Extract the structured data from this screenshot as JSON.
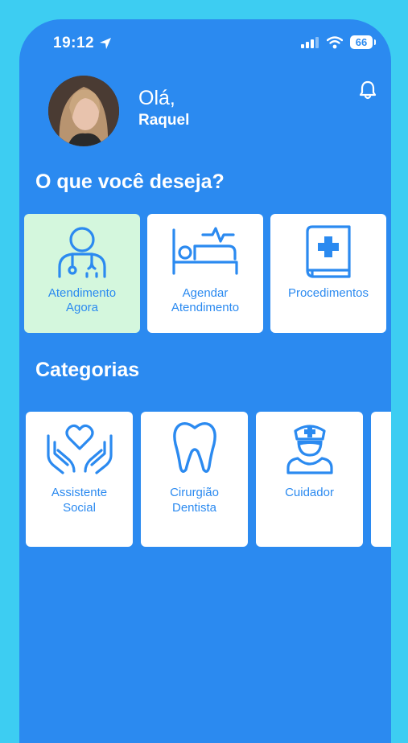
{
  "status_bar": {
    "time": "19:12",
    "battery": "66"
  },
  "header": {
    "greeting": "Olá,",
    "user_name": "Raquel"
  },
  "sections": {
    "wish_title": "O que você deseja?",
    "categories_title": "Categorias"
  },
  "actions": [
    {
      "label_line1": "Atendimento",
      "label_line2": "Agora",
      "icon": "doctor-icon",
      "active": true
    },
    {
      "label_line1": "Agendar",
      "label_line2": "Atendimento",
      "icon": "hospital-bed-icon",
      "active": false
    },
    {
      "label_line1": "Procedimentos",
      "label_line2": "",
      "icon": "medical-book-icon",
      "active": false
    }
  ],
  "categories": [
    {
      "label_line1": "Assistente",
      "label_line2": "Social",
      "icon": "hands-heart-icon"
    },
    {
      "label_line1": "Cirurgião",
      "label_line2": "Dentista",
      "icon": "tooth-icon"
    },
    {
      "label_line1": "Cuidador",
      "label_line2": "",
      "icon": "nurse-icon"
    }
  ],
  "colors": {
    "primary": "#2b8af0",
    "outer": "#3dcdf2",
    "active_card": "#d4f7dd",
    "card": "#ffffff"
  }
}
